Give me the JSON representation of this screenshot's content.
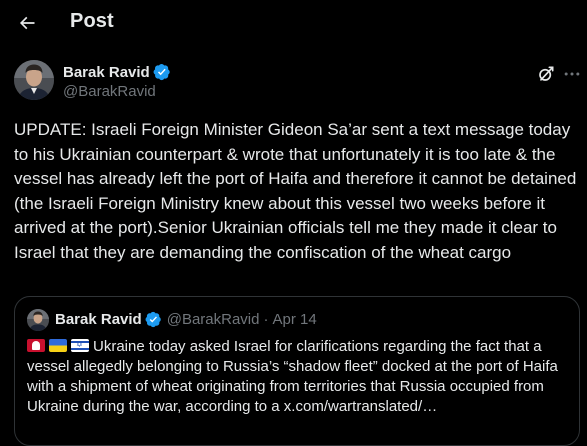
{
  "header": {
    "title": "Post",
    "back_icon": "arrow-left-icon"
  },
  "post": {
    "author": {
      "name": "Barak Ravid",
      "handle": "@BarakRavid",
      "verified": true,
      "verified_color": "#1d9bf0"
    },
    "actions": {
      "grok_icon": "grok-icon",
      "more_icon": "more-horizontal-icon"
    },
    "text": "UPDATE: Israeli Foreign Minister Gideon Sa’ar sent a text message today to his Ukrainian counterpart & wrote that unfortunately it is too late & the vessel has already left the port of Haifa and therefore it cannot be detained (the Israeli Foreign Ministry knew about this vessel two weeks before it arrived at the port).Senior Ukrainian officials tell me they made it clear to Israel that they are demanding the confiscation of the wheat cargo"
  },
  "quote": {
    "author": {
      "name": "Barak Ravid",
      "handle": "@BarakRavid",
      "separator": "·",
      "date": "Apr 14"
    },
    "flags": [
      "alarm-light-icon",
      "ukraine-flag-icon",
      "israel-flag-icon"
    ],
    "text": "Ukraine today asked Israel for clarifications regarding the fact that a vessel allegedly belonging to Russia’s “shadow fleet” docked at the port of Haifa with a shipment of wheat originating from territories that Russia occupied from Ukraine during the war, according to a x.com/wartranslated/…"
  },
  "colors": {
    "background": "#000000",
    "text_primary": "#e7e9ea",
    "text_secondary": "#71767b",
    "border": "#2f3336",
    "accent": "#1d9bf0"
  }
}
